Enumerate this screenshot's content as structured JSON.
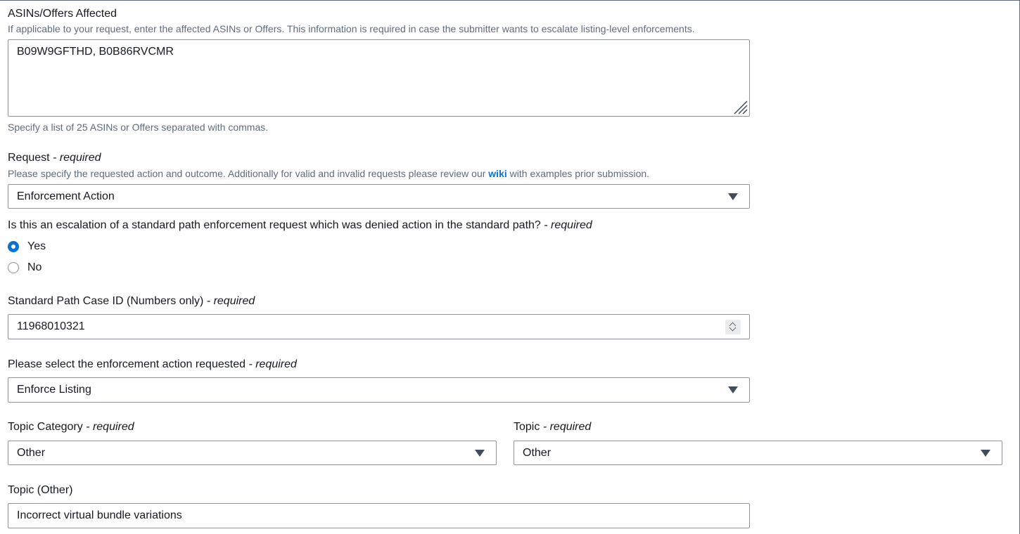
{
  "asins": {
    "label": "ASINs/Offers Affected",
    "description": "If applicable to your request, enter the affected ASINs or Offers. This information is required in case the submitter wants to escalate listing-level enforcements.",
    "value": "B09W9GFTHD, B0B86RVCMR",
    "hint": "Specify a list of 25 ASINs or Offers separated with commas."
  },
  "request": {
    "label": "Request",
    "required": "- required",
    "description_before": "Please specify the requested action and outcome. Additionally for valid and invalid requests please review our ",
    "wiki_link": "wiki",
    "description_after": " with examples prior submission.",
    "selected": "Enforcement Action"
  },
  "escalation": {
    "question": "Is this an escalation of a standard path enforcement request which was denied action in the standard path?",
    "required": "- required",
    "options": [
      {
        "label": "Yes",
        "checked": true
      },
      {
        "label": "No",
        "checked": false
      }
    ]
  },
  "case_id": {
    "label": "Standard Path Case ID (Numbers only)",
    "required": "- required",
    "value": "11968010321"
  },
  "enforcement_action": {
    "label": "Please select the enforcement action requested",
    "required": "- required",
    "selected": "Enforce Listing"
  },
  "topic_category": {
    "label": "Topic Category",
    "required": "- required",
    "selected": "Other"
  },
  "topic": {
    "label": "Topic",
    "required": "- required",
    "selected": "Other"
  },
  "topic_other": {
    "label": "Topic (Other)",
    "value": "Incorrect virtual bundle variations"
  },
  "icons": {
    "caret": "caret-down-icon",
    "resize": "resize-handle-icon",
    "spinner": "number-stepper-icon"
  },
  "colors": {
    "accent": "#0972d3",
    "border": "#8d9399",
    "text": "#16191f",
    "muted": "#5f6b7a"
  }
}
